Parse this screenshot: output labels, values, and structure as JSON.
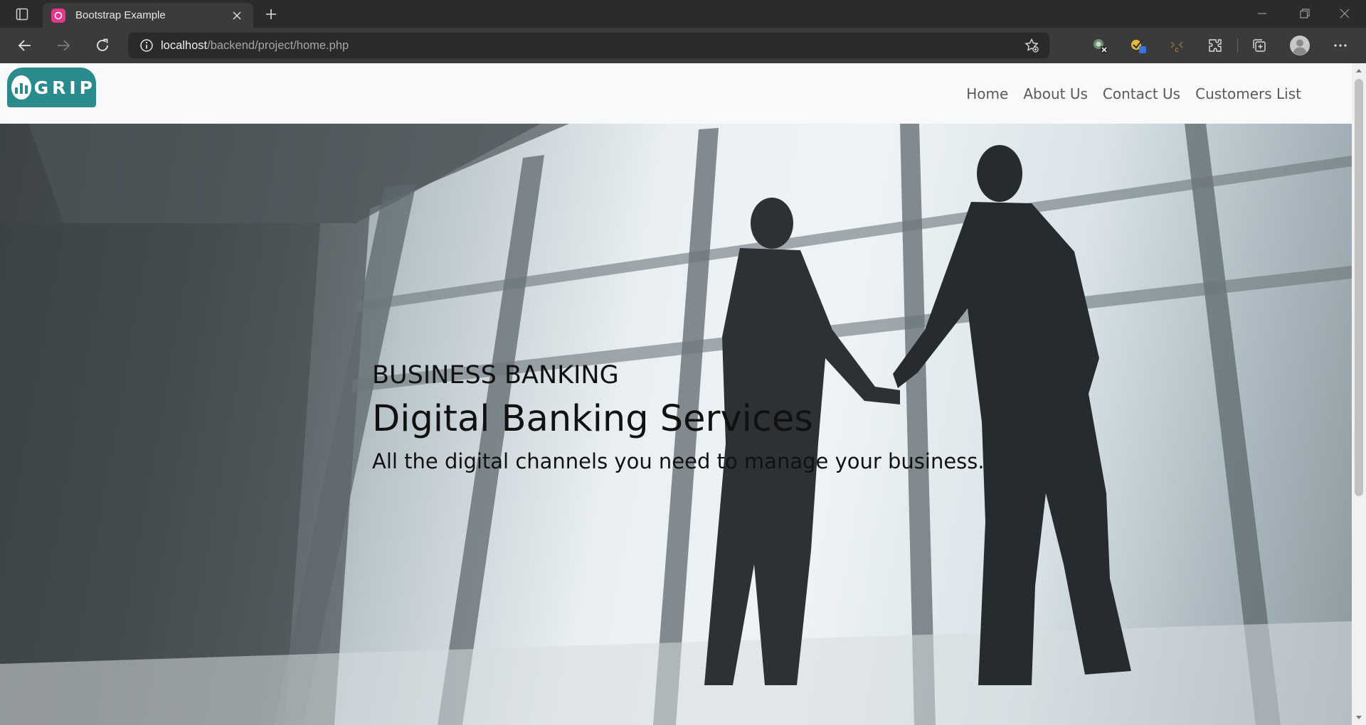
{
  "browser": {
    "tab_title": "Bootstrap Example",
    "url_host": "localhost",
    "url_path": "/backend/project/home.php"
  },
  "site": {
    "logo_text": "GRIP",
    "nav": [
      "Home",
      "About Us",
      "Contact Us",
      "Customers List"
    ]
  },
  "hero": {
    "kicker": "BUSINESS BANKING",
    "title": "Digital Banking Services",
    "subtitle": "All the digital channels you need to manage your business."
  },
  "colors": {
    "brand_teal": "#2b8a8d",
    "tab_favicon": "#e8368f",
    "navbar_bg": "#f8f9fa"
  }
}
